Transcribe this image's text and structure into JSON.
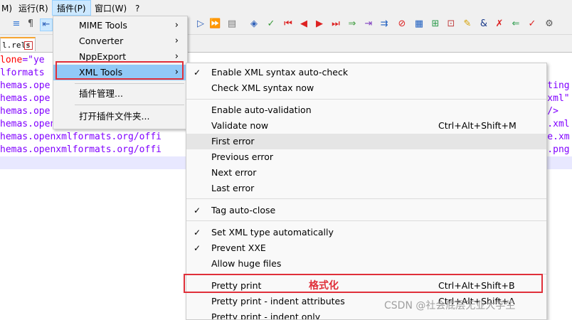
{
  "menubar": {
    "items": [
      "M)",
      "运行(R)",
      "插件(P)",
      "窗口(W)",
      "?"
    ]
  },
  "tab": {
    "name": "l.rels",
    "close": "×"
  },
  "editor": {
    "lines": [
      {
        "a": "lone",
        "b": "=\"ye",
        "c": ""
      },
      {
        "a": "lformats",
        "b": "",
        "c": ""
      },
      {
        "a": "hemas.ope",
        "b": "",
        "c": "bSetting"
      },
      {
        "a": "hemas.ope",
        "b": "",
        "c": "ngs.xml\""
      },
      {
        "a": "hemas.ope",
        "b": "",
        "c": "xml\"/>"
      },
      {
        "a": "hemas.openxmlformats.org/offi",
        "b": "",
        "c": "eme1.xml"
      },
      {
        "a": "hemas.openxmlformats.org/offi",
        "b": "",
        "c": "Table.xm"
      },
      {
        "a": "hemas.openxmlformats.org/offi",
        "b": "",
        "c": "age1.png"
      }
    ]
  },
  "plugin_menu": {
    "items": [
      {
        "label": "MIME Tools",
        "arrow": "›"
      },
      {
        "label": "Converter",
        "arrow": "›"
      },
      {
        "label": "NppExport",
        "arrow": "›"
      },
      {
        "label": "XML Tools",
        "arrow": "›"
      },
      {
        "label": "插件管理...",
        "arrow": ""
      },
      {
        "label": "打开插件文件夹...",
        "arrow": ""
      }
    ]
  },
  "xml_menu": {
    "items": [
      {
        "check": "✓",
        "label": "Enable XML syntax auto-check",
        "shortcut": ""
      },
      {
        "check": "",
        "label": "Check XML syntax now",
        "shortcut": ""
      },
      {
        "check": "",
        "label": "Enable auto-validation",
        "shortcut": ""
      },
      {
        "check": "",
        "label": "Validate now",
        "shortcut": "Ctrl+Alt+Shift+M"
      },
      {
        "check": "",
        "label": "First error",
        "shortcut": ""
      },
      {
        "check": "",
        "label": "Previous error",
        "shortcut": ""
      },
      {
        "check": "",
        "label": "Next error",
        "shortcut": ""
      },
      {
        "check": "",
        "label": "Last error",
        "shortcut": ""
      },
      {
        "check": "✓",
        "label": "Tag auto-close",
        "shortcut": ""
      },
      {
        "check": "✓",
        "label": "Set XML type automatically",
        "shortcut": ""
      },
      {
        "check": "✓",
        "label": "Prevent XXE",
        "shortcut": ""
      },
      {
        "check": "",
        "label": "Allow huge files",
        "shortcut": ""
      },
      {
        "check": "",
        "label": "Pretty print",
        "shortcut": "Ctrl+Alt+Shift+B"
      },
      {
        "check": "",
        "label": "Pretty print - indent attributes",
        "shortcut": "Ctrl+Alt+Shift+A"
      },
      {
        "check": "",
        "label": "Pretty print - indent only",
        "shortcut": ""
      }
    ]
  },
  "annotation": "格式化",
  "watermark": "CSDN @社会底层无业大学生",
  "colors": {
    "highlight_box": "#e0303a",
    "menu_selected": "#91c9f7",
    "tab_accent": "#f7a531"
  }
}
